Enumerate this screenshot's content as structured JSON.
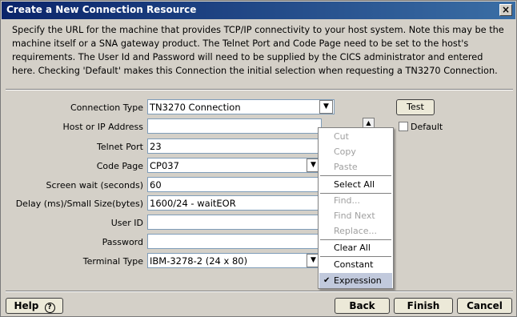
{
  "window": {
    "title": "Create a New Connection Resource",
    "close_icon": "close-icon"
  },
  "description": "Specify the URL for the machine that provides TCP/IP connectivity to your host system.  Note this may be the machine itself or a SNA gateway product. The Telnet Port and Code Page need to be set to the host's requirements. The User Id and Password will need to be supplied by the CICS administrator and entered here. Checking 'Default' makes this Connection the initial selection when requesting a TN3270 Connection.",
  "form": {
    "connection_type": {
      "label": "Connection Type",
      "value": "TN3270 Connection"
    },
    "host": {
      "label": "Host or IP Address",
      "value": ""
    },
    "telnet_port": {
      "label": "Telnet Port",
      "value": "23"
    },
    "code_page": {
      "label": "Code Page",
      "value": "CP037"
    },
    "screen_wait": {
      "label": "Screen wait (seconds)",
      "value": "60"
    },
    "delay": {
      "label": "Delay (ms)/Small Size(bytes)",
      "value": "1600/24 - waitEOR"
    },
    "user_id": {
      "label": "User ID",
      "value": ""
    },
    "password": {
      "label": "Password",
      "value": ""
    },
    "terminal_type": {
      "label": "Terminal Type",
      "value": "IBM-3278-2 (24 x 80)"
    }
  },
  "test_button": "Test",
  "default_checkbox": {
    "label": "Default",
    "checked": false
  },
  "context_menu": {
    "items": [
      {
        "label": "Cut",
        "enabled": false
      },
      {
        "label": "Copy",
        "enabled": false
      },
      {
        "label": "Paste",
        "enabled": false
      },
      {
        "label": "Select All",
        "enabled": true
      },
      {
        "label": "Find...",
        "enabled": false
      },
      {
        "label": "Find Next",
        "enabled": false
      },
      {
        "label": "Replace...",
        "enabled": false
      },
      {
        "label": "Clear All",
        "enabled": true
      },
      {
        "label": "Constant",
        "enabled": true
      },
      {
        "label": "Expression",
        "enabled": true,
        "checked": true,
        "highlighted": true
      }
    ]
  },
  "footer": {
    "help": "Help",
    "back": "Back",
    "finish": "Finish",
    "cancel": "Cancel"
  },
  "colors": {
    "titlebar_start": "#0a246a",
    "titlebar_end": "#3a6ea5",
    "menu_highlight": "#c1c9dc"
  }
}
